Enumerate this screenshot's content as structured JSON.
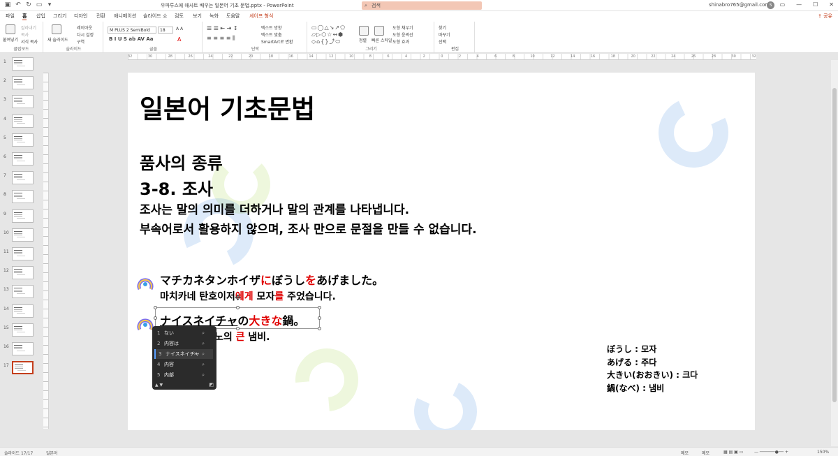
{
  "titlebar": {
    "doc_title": "우파루스에 애사트 배우는 일본어 기초 문법.pptx  -  PowerPoint",
    "search_placeholder": "검색",
    "account": "shinabro765@gmail.com",
    "avatar_letter": "S"
  },
  "tabs": [
    "파일",
    "홈",
    "삽입",
    "그리기",
    "디자인",
    "전환",
    "애니메이션",
    "슬라이드 쇼",
    "검토",
    "보기",
    "녹화",
    "도움말",
    "셰이프 형식"
  ],
  "active_tab": "홈",
  "share_label": "공유",
  "ribbon": {
    "paste": "붙여넣기",
    "cut": "잘라내기",
    "copy": "복사",
    "format_painter": "서식 복사",
    "clipboard": "클립보드",
    "new_slide": "새 슬라이드",
    "layout": "레이아웃",
    "reset": "다시 설정",
    "section": "구역",
    "slides": "슬라이드",
    "font_name": "M PLUS 2 SemiBold",
    "font_size": "18",
    "font": "글꼴",
    "text_direction": "텍스트 방향",
    "align_text": "텍스트 맞춤",
    "smartart": "SmartArt로 변환",
    "paragraph": "단락",
    "arrange": "정렬",
    "quick_styles": "빠른 스타일",
    "drawing": "그리기",
    "shape_fill": "도형 채우기",
    "shape_outline": "도형 윤곽선",
    "shape_effects": "도형 효과",
    "find": "찾기",
    "replace": "바꾸기",
    "select": "선택",
    "editing": "편집"
  },
  "ruler_numbers": [
    "32",
    "30",
    "28",
    "26",
    "24",
    "22",
    "20",
    "18",
    "16",
    "14",
    "12",
    "10",
    "8",
    "6",
    "4",
    "2",
    "0",
    "2",
    "4",
    "6",
    "8",
    "10",
    "12",
    "14",
    "16",
    "18",
    "20",
    "22",
    "24",
    "26",
    "28",
    "30",
    "32"
  ],
  "thumbnails": [
    "1",
    "2",
    "3",
    "4",
    "5",
    "6",
    "7",
    "8",
    "9",
    "10",
    "11",
    "12",
    "13",
    "14",
    "15",
    "16",
    "17"
  ],
  "active_thumbnail": "17",
  "slide": {
    "title": "일본어 기초문법",
    "heading1": "품사의 종류",
    "heading2": "3-8. 조사",
    "body1": "조사는 말의 의미를 더하거나 말의 관계를 나타냅니다.",
    "body2": "부속어로서 활용하지 않으며, 조사 만으로 문절을 만들 수 없습니다.",
    "ex1_jp_a": "マチカネタンホイザ",
    "ex1_jp_b": "に",
    "ex1_jp_c": "ぼうし",
    "ex1_jp_d": "を",
    "ex1_jp_e": "あげました。",
    "ex1_ko_a": "마치카네 탄호이저",
    "ex1_ko_b": "에게",
    "ex1_ko_c": " 모자",
    "ex1_ko_d": "를",
    "ex1_ko_e": " 주었습니다.",
    "ex2_jp_a": "ナイスネイチャ",
    "ex2_jp_b": "の",
    "ex2_jp_c": "大きな",
    "ex2_jp_d": "鍋。",
    "ex2_ko_a": "노의 ",
    "ex2_ko_b": "큰",
    "ex2_ko_c": " 냄비.",
    "vocab": [
      "ぼうし : 모자",
      "あげる : 주다",
      "大きい(おおきい) : 크다",
      "鍋(なべ) : 냄비"
    ]
  },
  "ime": {
    "candidates": [
      {
        "num": "1",
        "text": "ない"
      },
      {
        "num": "2",
        "text": "内容は"
      },
      {
        "num": "3",
        "text": "ナイスネイチャ"
      },
      {
        "num": "4",
        "text": "内容"
      },
      {
        "num": "5",
        "text": "内部"
      }
    ],
    "selected_index": 2
  },
  "status": {
    "slide_info": "슬라이드 17/17",
    "language": "일본어",
    "notes": "메모",
    "comments": "메모",
    "zoom": "150%"
  },
  "colors": {
    "accent": "#c43e1c",
    "red_text": "#e00000"
  }
}
